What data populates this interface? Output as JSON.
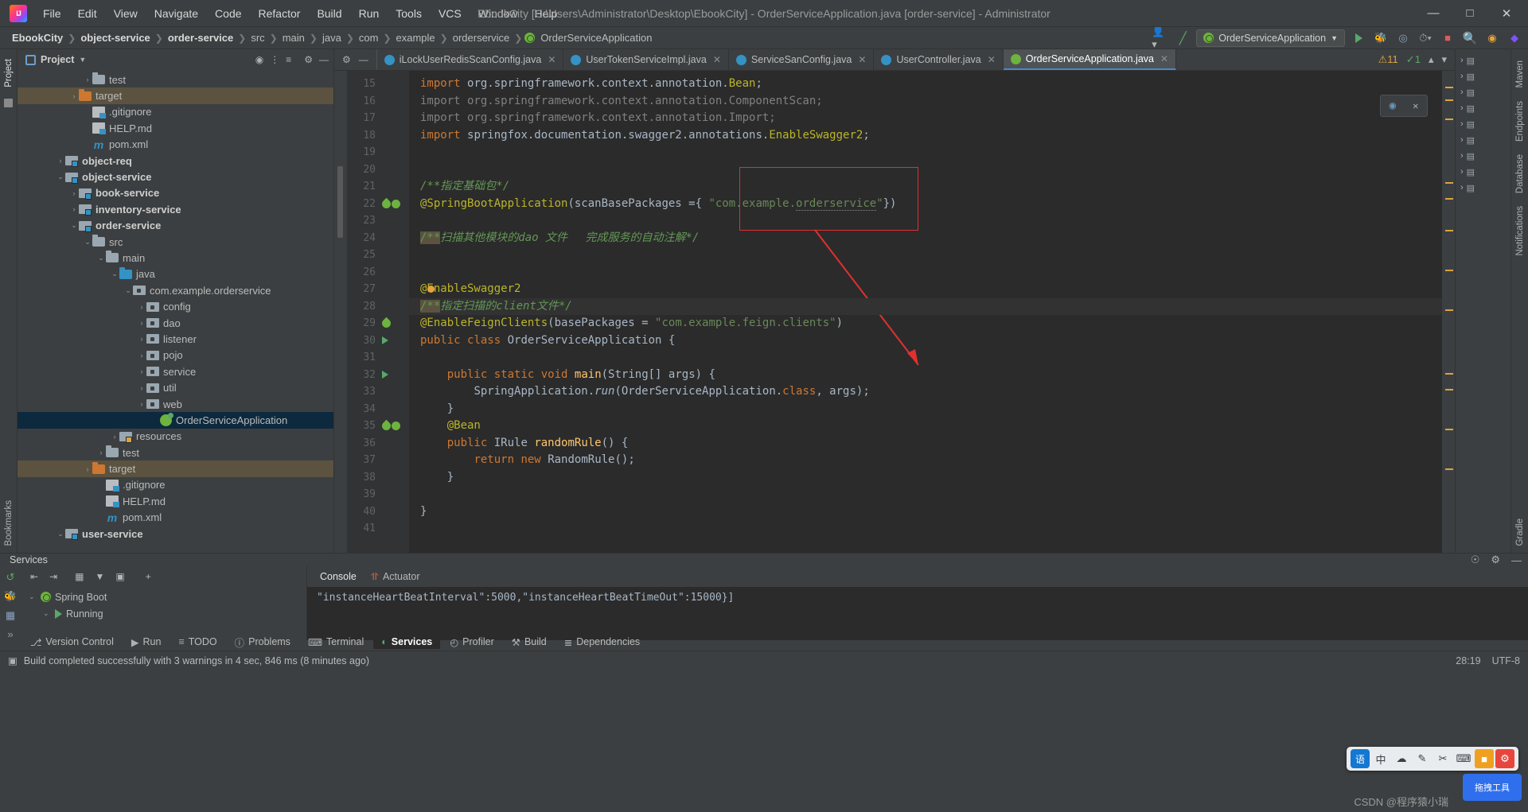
{
  "titlebar": {
    "logo": "intellij-idea-logo",
    "menus": [
      "File",
      "Edit",
      "View",
      "Navigate",
      "Code",
      "Refactor",
      "Build",
      "Run",
      "Tools",
      "VCS",
      "Window",
      "Help"
    ],
    "window_title": "EbookCity [C:\\Users\\Administrator\\Desktop\\EbookCity] - OrderServiceApplication.java [order-service] - Administrator",
    "minimize": "—",
    "maximize": "□",
    "close": "✕"
  },
  "navbar": {
    "crumbs": [
      {
        "label": "EbookCity",
        "bold": true
      },
      {
        "label": "object-service",
        "bold": true
      },
      {
        "label": "order-service",
        "bold": true
      },
      {
        "label": "src",
        "bold": false
      },
      {
        "label": "main",
        "bold": false
      },
      {
        "label": "java",
        "bold": false
      },
      {
        "label": "com",
        "bold": false
      },
      {
        "label": "example",
        "bold": false
      },
      {
        "label": "orderservice",
        "bold": false
      },
      {
        "label": "OrderServiceApplication",
        "bold": false,
        "icon": "spring-class-icon"
      }
    ],
    "run_config": "OrderServiceApplication",
    "icons": [
      "user-icon",
      "hammer-icon",
      "run-icon",
      "debug-icon",
      "profile-icon",
      "stop-icon",
      "search-icon",
      "plugin-icon",
      "browser-icon"
    ]
  },
  "project_panel": {
    "title": "Project",
    "header_icons": [
      "locate-icon",
      "collapse-icon",
      "expand-icon",
      "settings-icon",
      "hide-icon"
    ],
    "tree": [
      {
        "indent": 4,
        "arrow": "›",
        "icon": "folder",
        "label": "test",
        "bold": false
      },
      {
        "indent": 3,
        "arrow": "›",
        "icon": "folder-orange",
        "label": "target",
        "bold": false,
        "state": "highlight"
      },
      {
        "indent": 4,
        "arrow": "",
        "icon": "file-git",
        "label": ".gitignore",
        "bold": false
      },
      {
        "indent": 4,
        "arrow": "",
        "icon": "file-md",
        "label": "HELP.md",
        "bold": false
      },
      {
        "indent": 4,
        "arrow": "",
        "icon": "maven",
        "label": "pom.xml",
        "bold": false
      },
      {
        "indent": 2,
        "arrow": "›",
        "icon": "module",
        "label": "object-req",
        "bold": true
      },
      {
        "indent": 2,
        "arrow": "⌄",
        "icon": "module",
        "label": "object-service",
        "bold": true
      },
      {
        "indent": 3,
        "arrow": "›",
        "icon": "module",
        "label": "book-service",
        "bold": true
      },
      {
        "indent": 3,
        "arrow": "›",
        "icon": "module",
        "label": "inventory-service",
        "bold": true
      },
      {
        "indent": 3,
        "arrow": "⌄",
        "icon": "module",
        "label": "order-service",
        "bold": true
      },
      {
        "indent": 4,
        "arrow": "⌄",
        "icon": "folder",
        "label": "src",
        "bold": false
      },
      {
        "indent": 5,
        "arrow": "⌄",
        "icon": "folder",
        "label": "main",
        "bold": false
      },
      {
        "indent": 6,
        "arrow": "⌄",
        "icon": "folder-blue",
        "label": "java",
        "bold": false
      },
      {
        "indent": 7,
        "arrow": "⌄",
        "icon": "package",
        "label": "com.example.orderservice",
        "bold": false
      },
      {
        "indent": 8,
        "arrow": "›",
        "icon": "package",
        "label": "config",
        "bold": false
      },
      {
        "indent": 8,
        "arrow": "›",
        "icon": "package",
        "label": "dao",
        "bold": false
      },
      {
        "indent": 8,
        "arrow": "›",
        "icon": "package",
        "label": "listener",
        "bold": false
      },
      {
        "indent": 8,
        "arrow": "›",
        "icon": "package",
        "label": "pojo",
        "bold": false
      },
      {
        "indent": 8,
        "arrow": "›",
        "icon": "package",
        "label": "service",
        "bold": false
      },
      {
        "indent": 8,
        "arrow": "›",
        "icon": "package",
        "label": "util",
        "bold": false
      },
      {
        "indent": 8,
        "arrow": "›",
        "icon": "package",
        "label": "web",
        "bold": false
      },
      {
        "indent": 9,
        "arrow": "",
        "icon": "spring-class",
        "label": "OrderServiceApplication",
        "bold": false,
        "state": "selected"
      },
      {
        "indent": 6,
        "arrow": "›",
        "icon": "module-res",
        "label": "resources",
        "bold": false
      },
      {
        "indent": 5,
        "arrow": "›",
        "icon": "folder",
        "label": "test",
        "bold": false
      },
      {
        "indent": 4,
        "arrow": "›",
        "icon": "folder-orange",
        "label": "target",
        "bold": false,
        "state": "highlight"
      },
      {
        "indent": 5,
        "arrow": "",
        "icon": "file-git",
        "label": ".gitignore",
        "bold": false
      },
      {
        "indent": 5,
        "arrow": "",
        "icon": "file-md",
        "label": "HELP.md",
        "bold": false
      },
      {
        "indent": 5,
        "arrow": "",
        "icon": "maven",
        "label": "pom.xml",
        "bold": false
      },
      {
        "indent": 2,
        "arrow": "⌄",
        "icon": "module",
        "label": "user-service",
        "bold": true
      }
    ]
  },
  "left_stripe": [
    "Project",
    "Structure",
    "Bookmarks"
  ],
  "right_stripe": [
    "Maven",
    "Endpoints",
    "Database",
    "Notifications",
    "Gradle"
  ],
  "editor": {
    "tabs": [
      {
        "label": "iLockUserRedisScanConfig.java",
        "active": false
      },
      {
        "label": "UserTokenServiceImpl.java",
        "active": false
      },
      {
        "label": "ServiceSanConfig.java",
        "active": false
      },
      {
        "label": "UserController.java",
        "active": false
      },
      {
        "label": "OrderServiceApplication.java",
        "active": true
      }
    ],
    "tabs_right_icons": [
      "settings-icon",
      "minimize-icon",
      "more-icon"
    ],
    "inspection": {
      "warnings": "11",
      "errors": "1"
    },
    "lines": [
      {
        "n": 15,
        "gutter": [],
        "fold": "",
        "cur": false,
        "html": "<span class=\"kw\">import</span> <span class=\"pl\">org.springframework.context.annotation.</span><span class=\"ann\">Bean</span><span class=\"pl\">;</span>"
      },
      {
        "n": 16,
        "gutter": [],
        "fold": "",
        "cur": false,
        "html": "<span class=\"pl\" style=\"color:#808080\">import org.springframework.context.annotation.ComponentScan;</span>"
      },
      {
        "n": 17,
        "gutter": [],
        "fold": "",
        "cur": false,
        "html": "<span class=\"pl\" style=\"color:#808080\">import org.springframework.context.annotation.Import;</span>"
      },
      {
        "n": 18,
        "gutter": [],
        "fold": "⊖",
        "cur": false,
        "html": "<span class=\"kw\">import</span> <span class=\"pl\">springfox.documentation.swagger2.annotations.</span><span class=\"ann\">EnableSwagger2</span><span class=\"pl\">;</span>"
      },
      {
        "n": 19,
        "gutter": [],
        "fold": "",
        "cur": false,
        "html": ""
      },
      {
        "n": 20,
        "gutter": [],
        "fold": "",
        "cur": false,
        "html": ""
      },
      {
        "n": 21,
        "gutter": [],
        "fold": "",
        "cur": false,
        "html": "<span class=\"cmt\">/**指定基础包*/</span>"
      },
      {
        "n": 22,
        "gutter": [
          "leaf",
          "leafchk"
        ],
        "fold": "⊖",
        "cur": false,
        "html": "<span class=\"ann\">@SpringBootApplication</span><span class=\"pl\">(</span><span class=\"pl\">scanBasePackages =</span><span class=\"pl\">{ </span><span class=\"str\">\"com.example.<span class=\"wavy\">orderservice</span>\"</span><span class=\"pl\">})</span>"
      },
      {
        "n": 23,
        "gutter": [],
        "fold": "",
        "cur": false,
        "html": ""
      },
      {
        "n": 24,
        "gutter": [],
        "fold": "",
        "cur": false,
        "html": "<span class=\"cmt\"><span class=\"cmt-hl\">/**</span>扫描其他模块的dao 文件　 完成服务的自动注解*/</span>"
      },
      {
        "n": 25,
        "gutter": [],
        "fold": "",
        "cur": false,
        "html": ""
      },
      {
        "n": 26,
        "gutter": [],
        "fold": "",
        "cur": false,
        "html": ""
      },
      {
        "n": 27,
        "gutter": [],
        "fold": "",
        "cur": false,
        "html": "<span class=\"ann\">@E</span><span class=\"ann\">nableSwagger2</span>"
      },
      {
        "n": 28,
        "gutter": [],
        "fold": "",
        "cur": true,
        "html": "<span class=\"cmt\"><span class=\"cmt-hl\">/**</span>指定扫描的client文件*/</span>"
      },
      {
        "n": 29,
        "gutter": [
          "leaf-q"
        ],
        "fold": "⊖",
        "cur": false,
        "html": "<span class=\"ann\">@EnableFeignClients</span><span class=\"pl\">(</span><span class=\"pl\">basePackages = </span><span class=\"str\">\"com.example.feign.clients\"</span><span class=\"pl\">)</span>"
      },
      {
        "n": 30,
        "gutter": [
          "run"
        ],
        "fold": "",
        "cur": false,
        "html": "<span class=\"kw\">public</span> <span class=\"kw\">class</span> <span class=\"pl\">OrderServiceApplication {</span>"
      },
      {
        "n": 31,
        "gutter": [],
        "fold": "",
        "cur": false,
        "html": ""
      },
      {
        "n": 32,
        "gutter": [
          "run"
        ],
        "fold": "⊖",
        "cur": false,
        "html": "    <span class=\"kw\">public</span> <span class=\"kw\">static</span> <span class=\"kw\">void</span> <span class=\"fn\">main</span><span class=\"pl\">(String[] args) {</span>"
      },
      {
        "n": 33,
        "gutter": [],
        "fold": "",
        "cur": false,
        "html": "        <span class=\"pl\">SpringApplication.</span><span class=\"pl it\">run</span><span class=\"pl\">(OrderServiceApplication.</span><span class=\"kw\">class</span><span class=\"pl\">, args);</span>"
      },
      {
        "n": 34,
        "gutter": [],
        "fold": "⊕",
        "cur": false,
        "html": "    <span class=\"pl\">}</span>"
      },
      {
        "n": 35,
        "gutter": [
          "leaf",
          "leafchk"
        ],
        "fold": "",
        "cur": false,
        "html": "    <span class=\"ann\">@Bean</span>"
      },
      {
        "n": 36,
        "gutter": [],
        "fold": "⊖",
        "cur": false,
        "html": "    <span class=\"kw\">public</span> <span class=\"cls2\">IRule</span> <span class=\"fn\">randomRule</span><span class=\"pl\">() {</span>"
      },
      {
        "n": 37,
        "gutter": [],
        "fold": "",
        "cur": false,
        "html": "        <span class=\"kw\">return</span> <span class=\"kw\">new</span> <span class=\"pl\">RandomRule();</span>"
      },
      {
        "n": 38,
        "gutter": [],
        "fold": "⊕",
        "cur": false,
        "html": "    <span class=\"pl\">}</span>"
      },
      {
        "n": 39,
        "gutter": [],
        "fold": "",
        "cur": false,
        "html": ""
      },
      {
        "n": 40,
        "gutter": [],
        "fold": "",
        "cur": false,
        "html": "<span class=\"pl\">}</span>"
      },
      {
        "n": 41,
        "gutter": [],
        "fold": "",
        "cur": false,
        "html": ""
      }
    ],
    "annotation": {
      "label": "com.example",
      "box_color": "#e03030",
      "arrow_color": "#e03030"
    }
  },
  "services": {
    "title": "Services",
    "header_icons": [
      "help-icon",
      "settings-icon",
      "hide-icon"
    ],
    "toolbar_icons": [
      "expand-all-icon",
      "collapse-all-icon",
      "group-icon",
      "filter-icon",
      "layout-icon",
      "add-icon"
    ],
    "tree": [
      {
        "indent": 0,
        "arrow": "⌄",
        "icon": "spring-icon",
        "label": "Spring Boot"
      },
      {
        "indent": 1,
        "arrow": "⌄",
        "icon": "run-icon",
        "label": "Running"
      }
    ],
    "tabs": [
      {
        "label": "Console",
        "active": true,
        "icon": ""
      },
      {
        "label": "Actuator",
        "active": false,
        "icon": "actuator-icon"
      }
    ],
    "console_text": "\"instanceHeartBeatInterval\":5000,\"instanceHeartBeatTimeOut\":15000}]"
  },
  "toolwindow_bar": [
    {
      "label": "Version Control",
      "icon": "branch-icon",
      "active": false
    },
    {
      "label": "Run",
      "icon": "run-icon",
      "active": false
    },
    {
      "label": "TODO",
      "icon": "list-icon",
      "active": false
    },
    {
      "label": "Problems",
      "icon": "warning-icon",
      "active": false
    },
    {
      "label": "Terminal",
      "icon": "terminal-icon",
      "active": false
    },
    {
      "label": "Services",
      "icon": "services-icon",
      "active": true
    },
    {
      "label": "Profiler",
      "icon": "profiler-icon",
      "active": false
    },
    {
      "label": "Build",
      "icon": "hammer-icon",
      "active": false
    },
    {
      "label": "Dependencies",
      "icon": "dependencies-icon",
      "active": false
    }
  ],
  "status_bar": {
    "icon": "build-icon",
    "message": "Build completed successfully with 3 warnings in 4 sec, 846 ms (8 minutes ago)",
    "caret": "28:19",
    "encoding": "UTF-8"
  },
  "ime_bar": {
    "app": "语",
    "items": [
      "中",
      "☁",
      "✎",
      "✂",
      "⌨",
      "■",
      "⚙"
    ]
  },
  "watermark": {
    "csdn": "CSDN @程序猿小瑞",
    "float": "拖拽工具"
  }
}
